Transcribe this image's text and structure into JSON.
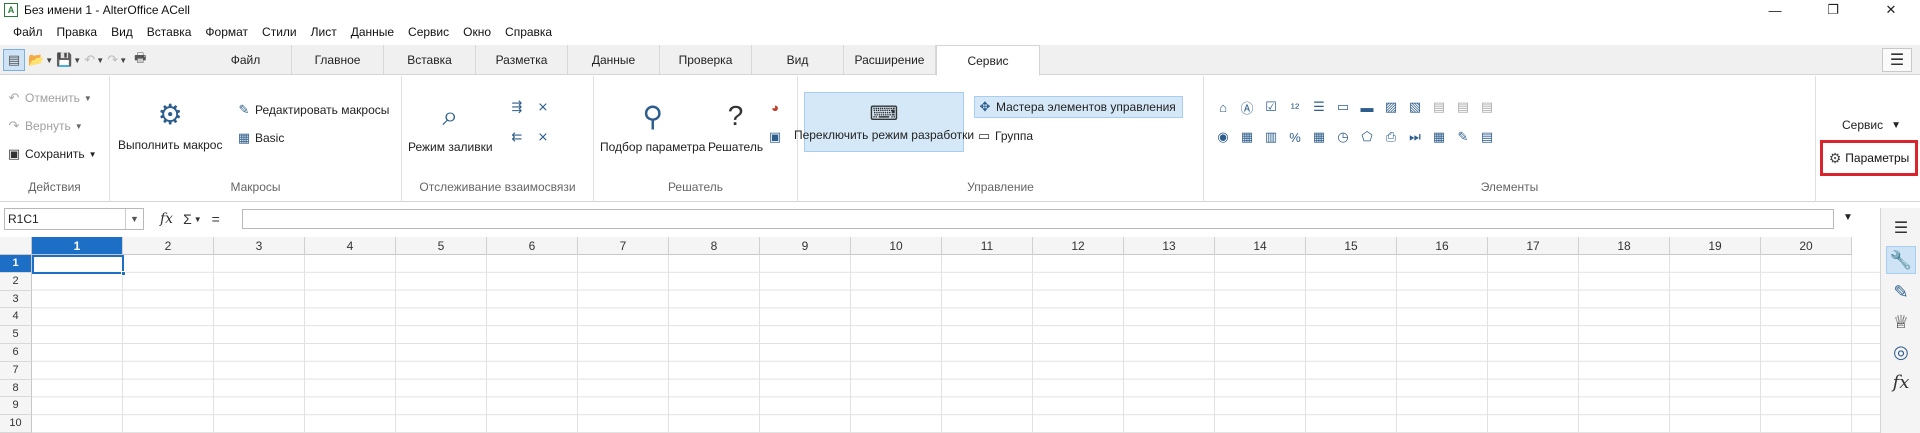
{
  "window": {
    "app_icon": "A",
    "title": "Без имени 1 - AlterOffice ACell",
    "minimize": "—",
    "restore": "❐",
    "close": "✕"
  },
  "menu": [
    "Файл",
    "Правка",
    "Вид",
    "Вставка",
    "Формат",
    "Стили",
    "Лист",
    "Данные",
    "Сервис",
    "Окно",
    "Справка"
  ],
  "tabs": [
    "Файл",
    "Главное",
    "Вставка",
    "Разметка",
    "Данные",
    "Проверка",
    "Вид",
    "Расширение",
    "Сервис"
  ],
  "active_tab": "Сервис",
  "ribbon": {
    "actions": {
      "undo": "Отменить",
      "redo": "Вернуть",
      "save": "Сохранить",
      "label": "Действия"
    },
    "macros": {
      "run": "Выполнить макрос",
      "edit": "Редактировать макросы",
      "basic": "Basic",
      "label": "Макросы"
    },
    "trace": {
      "fill_mode": "Режим заливки",
      "label": "Отслеживание взаимосвязи"
    },
    "solver": {
      "goal_seek": "Подбор параметра",
      "solver": "Решатель",
      "label": "Решатель"
    },
    "controls": {
      "design_mode": "Переключить режим разработки",
      "wizards": "Мастера элементов управления",
      "group": "Группа",
      "label": "Управление"
    },
    "elements": {
      "label": "Элементы"
    },
    "service": {
      "dropdown": "Сервис",
      "params": "Параметры"
    }
  },
  "formula_bar": {
    "name_box": "R1C1",
    "fx": "fx",
    "sum": "Σ",
    "equals": "="
  },
  "grid": {
    "columns": [
      "1",
      "2",
      "3",
      "4",
      "5",
      "6",
      "7",
      "8",
      "9",
      "10",
      "11",
      "12",
      "13",
      "14",
      "15",
      "16",
      "17",
      "18",
      "19",
      "20"
    ],
    "rows": [
      "1",
      "2",
      "3",
      "4",
      "5",
      "6",
      "7",
      "8",
      "9",
      "10"
    ],
    "active_column": "1",
    "active_row": "1"
  },
  "colors": {
    "accent": "#1c6fc4",
    "highlight_box": "#d9232d"
  }
}
